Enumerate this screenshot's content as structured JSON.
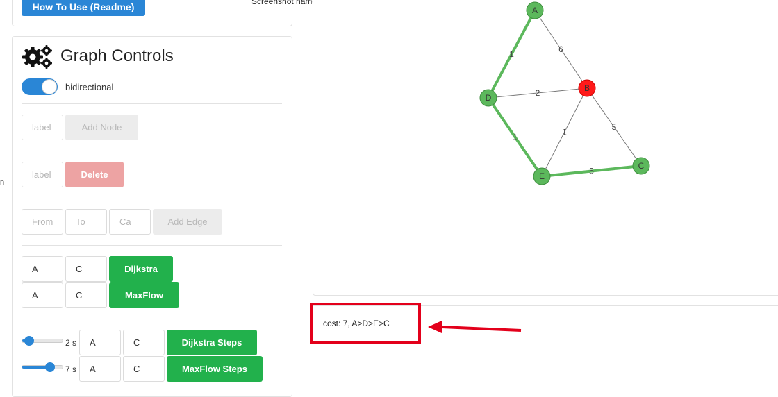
{
  "header": {
    "readme_label": "How To Use (Readme)",
    "screenshot_name": "Screenshot name",
    "edge_char": "n"
  },
  "controls": {
    "title": "Graph Controls",
    "icon": "gears-icon",
    "bidirectional_label": "bidirectional",
    "add_node": {
      "placeholder": "label",
      "button": "Add Node"
    },
    "delete_node": {
      "placeholder": "label",
      "button": "Delete"
    },
    "add_edge": {
      "from_placeholder": "From",
      "to_placeholder": "To",
      "cap_placeholder": "Ca",
      "button": "Add Edge"
    },
    "dijkstra": {
      "from": "A",
      "to": "C",
      "button": "Dijkstra"
    },
    "maxflow": {
      "from": "A",
      "to": "C",
      "button": "MaxFlow"
    },
    "dijkstra_steps": {
      "speed": "2 s",
      "from": "A",
      "to": "C",
      "button": "Dijkstra Steps",
      "slider_level": 0.15
    },
    "maxflow_steps": {
      "speed": "7 s",
      "from": "A",
      "to": "C",
      "button": "MaxFlow Steps",
      "slider_level": 0.65
    }
  },
  "graph": {
    "nodes": [
      {
        "id": "A",
        "color": "#5cb85c"
      },
      {
        "id": "B",
        "color": "#ff1a1a"
      },
      {
        "id": "C",
        "color": "#5cb85c"
      },
      {
        "id": "D",
        "color": "#5cb85c"
      },
      {
        "id": "E",
        "color": "#5cb85c"
      }
    ],
    "edges": [
      {
        "from": "A",
        "to": "D",
        "weight": "1",
        "highlighted": true
      },
      {
        "from": "A",
        "to": "B",
        "weight": "6",
        "highlighted": false
      },
      {
        "from": "D",
        "to": "B",
        "weight": "2",
        "highlighted": false
      },
      {
        "from": "D",
        "to": "E",
        "weight": "1",
        "highlighted": true
      },
      {
        "from": "B",
        "to": "E",
        "weight": "1",
        "highlighted": false
      },
      {
        "from": "B",
        "to": "C",
        "weight": "5",
        "highlighted": false
      },
      {
        "from": "E",
        "to": "C",
        "weight": "5",
        "highlighted": true
      }
    ],
    "highlight_color": "#5cb85c"
  },
  "result": {
    "text": "cost: 7, A>D>E>C"
  },
  "annotation": {
    "color": "#e3001b"
  },
  "colors": {
    "primary": "#2a86d6",
    "success": "#22b14c",
    "danger_disabled": "#eda3a3"
  }
}
